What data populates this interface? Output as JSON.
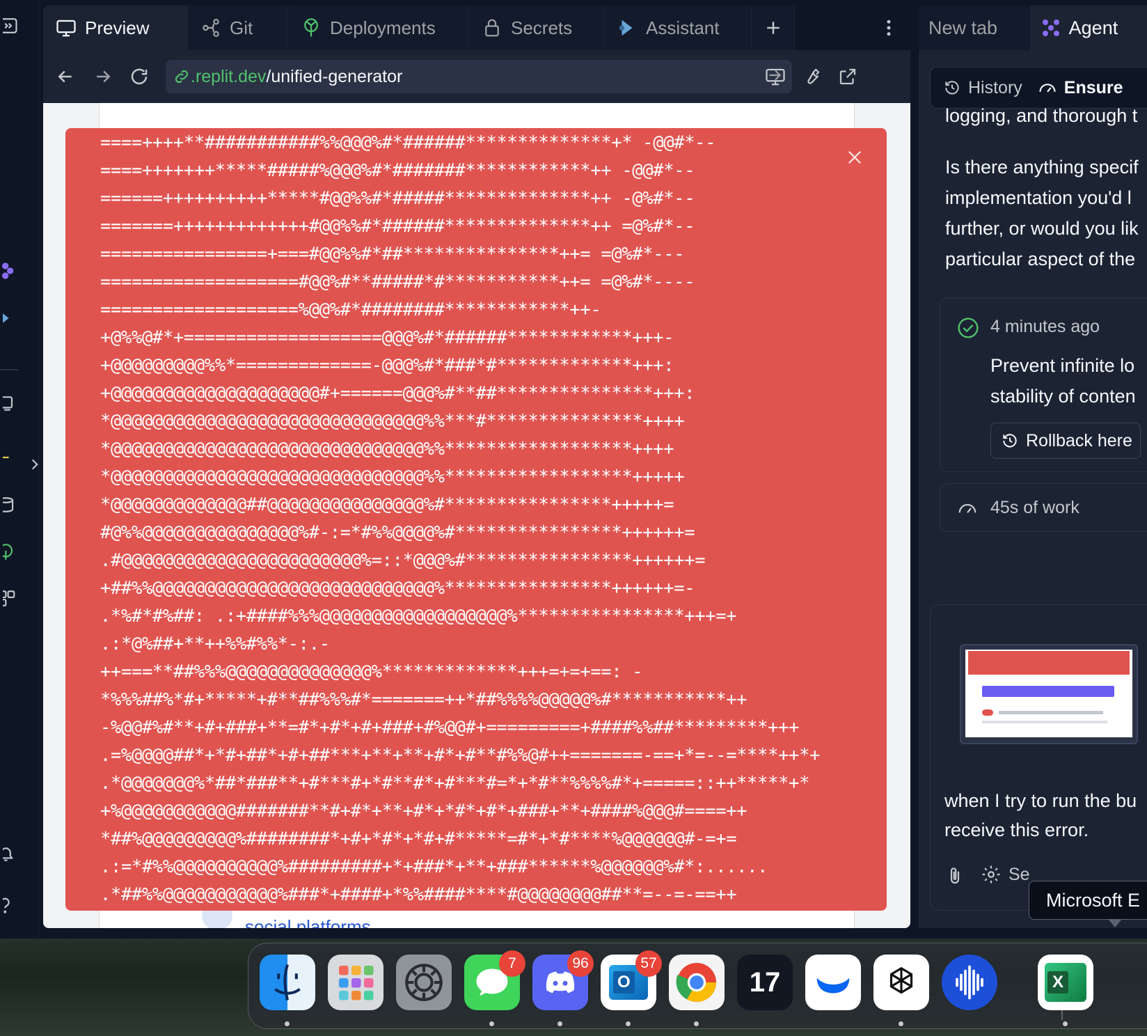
{
  "center": {
    "tabs": [
      {
        "label": "Preview",
        "icon": "monitor-icon",
        "active": true
      },
      {
        "label": "Git",
        "icon": "git-icon",
        "active": false
      },
      {
        "label": "Deployments",
        "icon": "deployments-icon",
        "active": false
      },
      {
        "label": "Secrets",
        "icon": "lock-icon",
        "active": false
      },
      {
        "label": "Assistant",
        "icon": "assistant-icon",
        "active": false
      }
    ],
    "url": {
      "domain": ".replit.dev",
      "path": "/unified-generator"
    },
    "page": {
      "link_text": "social platforms"
    },
    "error_overlay": {
      "lines": [
        "====++++**###########%%@@@%#*######**************+* -@@#*--",
        "====+++++++*****#####%@@@%#*#######************++ -@@#*--",
        "======++++++++++*****#@@%%#*#####**************++ -@%#*--",
        "=======+++++++++++++#@@%%#*######**************++ =@%#*--",
        "================+===#@@%%#*##***************++= =@%#*---",
        "===================#@@%#**#####*#***********++= =@%#*----",
        "===================%@@%#*########************++-",
        "+@%%@#*+===================@@@%#*######************+++-",
        "+@@@@@@@@@%%*=============-@@@%#*###*#*************+++:",
        "+@@@@@@@@@@@@@@@@@@@@#+======@@@%#**##***************+++:",
        "*@@@@@@@@@@@@@@@@@@@@@@@@@@@@@@%%***#***************++++",
        "*@@@@@@@@@@@@@@@@@@@@@@@@@@@@@@%%******************++++",
        "*@@@@@@@@@@@@@@@@@@@@@@@@@@@@@@%%******************+++++",
        "*@@@@@@@@@@@@@##@@@@@@@@@@@@@@@%#****************+++++=",
        "#@%%@@@@@@@@@@@@@@@%#-:=*#%%@@@@%#****************++++++=",
        ".#@@@@@@@@@@@@@@@@@@@@@@@%=::*@@@%#****************++++++=",
        "+##%%@@@@@@@@@@@@@@@@@@@@@@@@@@@%****************++++++=-",
        ".*%#*#%##: .:+####%%%@@@@@@@@@@@@@@@@@@%****************+++=+",
        ".:*@%##+**++%%#%%*-:.-",
        "++===**##%%%@@@@@@@@@@@@@@%*************+++=+=+==: -",
        "*%%%##%*#+*****+#**##%%%#*=======++*##%%%%@@@@@%#***********++",
        "-%@@#%#**+#+###+**=#*+#*+#+###+#%@@#+=========+####%%##*********+++",
        ".=%@@@@##*+*#+##*+#+##***+**+**+#*+#**#%%@#++=======-==+*=--=****++*+",
        ".*@@@@@@@%*##*###**+#***#+*#**#*+#***#=*+*#**%%%%#*+=====::++*****+*",
        "+%@@@@@@@@@@@#######**#+#*+**+#*+*#*+#*+###+**+####%@@@#====++",
        "*##%@@@@@@@@@%########*+#+*#*+*#+#*****=#*+*#****%@@@@@@#-=+=",
        ".:=*#%%@@@@@@@@@@%#########+*+###*+**+###******%@@@@@@%#*:......",
        ".*##%%@@@@@@@@@@@%###*+####+*%%####****#@@@@@@@@##**=--=-==++",
        ".:#%%@@@@@@@@@@@%###*.:###*..+##***%@@@@@@%#**+==----=-"
      ]
    }
  },
  "right": {
    "tabs": [
      {
        "label": "New tab",
        "active": false
      },
      {
        "label": "Agent",
        "icon": "agent-icon",
        "active": true
      }
    ],
    "toolbar": {
      "history": "History",
      "ensure": "Ensure"
    },
    "message_lines": [
      "logging, and thorough t",
      "",
      "Is there anything specif",
      "implementation you'd l",
      "further, or would you lik",
      "particular aspect of the"
    ],
    "checkpoint": {
      "time": "4 minutes ago",
      "title_lines": [
        "Prevent infinite lo",
        "stability of conten"
      ],
      "rollback_label": "Rollback here"
    },
    "work": {
      "label": "45s of work"
    },
    "composer": {
      "message_lines": [
        "when I try to run the bu",
        "receive this error."
      ],
      "settings_label": "Se"
    },
    "tooltip": "Microsoft E"
  },
  "dock": {
    "apps": [
      {
        "name": "finder",
        "badge": "",
        "running": true
      },
      {
        "name": "launchpad",
        "badge": "",
        "running": false
      },
      {
        "name": "system-settings",
        "badge": "",
        "running": false
      },
      {
        "name": "messages",
        "badge": "7",
        "running": true
      },
      {
        "name": "discord",
        "badge": "96",
        "running": true
      },
      {
        "name": "outlook",
        "badge": "57",
        "running": true
      },
      {
        "name": "chrome",
        "badge": "",
        "running": true
      },
      {
        "name": "tradingview",
        "badge": "",
        "running": false
      },
      {
        "name": "tonkeeper",
        "badge": "",
        "running": false
      },
      {
        "name": "chatgpt",
        "badge": "",
        "running": true
      },
      {
        "name": "voice-app",
        "badge": "",
        "running": false
      },
      {
        "name": "excel",
        "badge": "",
        "running": true
      }
    ],
    "labels": {
      "excel": "X",
      "tradingview": "17",
      "outlook": "O"
    }
  },
  "colors": {
    "error_bg": "#e05450",
    "accent": "#4fc26b",
    "link": "#2a58c9",
    "agent": "#8a6cf3"
  }
}
